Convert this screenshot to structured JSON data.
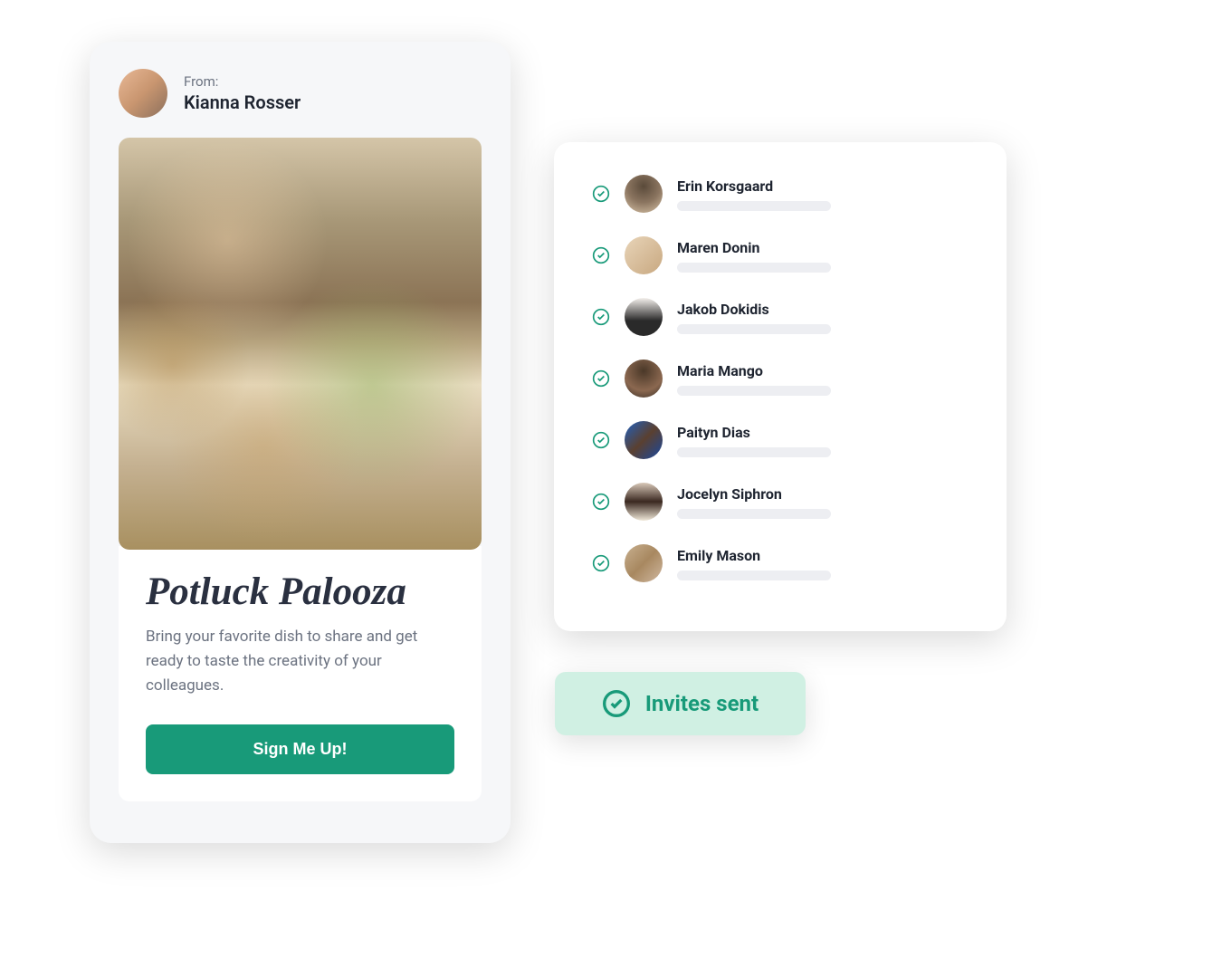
{
  "invite": {
    "from_label": "From:",
    "from_name": "Kianna Rosser",
    "event_title": "Potluck Palooza",
    "event_description": "Bring your favorite dish to share and get ready to taste the creativity of your colleagues.",
    "signup_label": "Sign Me Up!"
  },
  "invitees": [
    {
      "name": "Erin Korsgaard"
    },
    {
      "name": "Maren Donin"
    },
    {
      "name": "Jakob Dokidis"
    },
    {
      "name": "Maria Mango"
    },
    {
      "name": "Paityn Dias"
    },
    {
      "name": "Jocelyn Siphron"
    },
    {
      "name": "Emily Mason"
    }
  ],
  "status_badge": {
    "label": "Invites sent"
  },
  "colors": {
    "primary": "#189a79",
    "badge_bg": "#d0f0e3",
    "text_dark": "#1e2430",
    "text_muted": "#6b7280"
  }
}
